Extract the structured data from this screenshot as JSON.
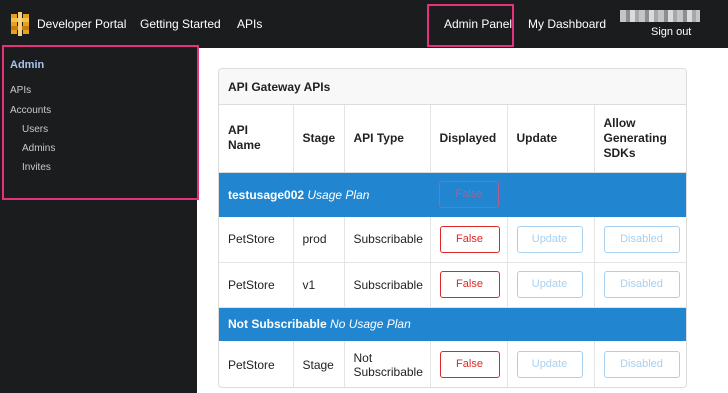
{
  "nav": {
    "brand": "Developer Portal",
    "getting_started": "Getting Started",
    "apis": "APIs",
    "admin_panel": "Admin Panel",
    "my_dashboard": "My Dashboard",
    "sign_out": "Sign out",
    "logo_icon": "developer-portal-logo-icon"
  },
  "sidebar": {
    "heading": "Admin",
    "items": [
      {
        "label": "APIs"
      },
      {
        "label": "Accounts"
      },
      {
        "label": "Users"
      },
      {
        "label": "Admins"
      },
      {
        "label": "Invites"
      }
    ]
  },
  "panel": {
    "title": "API Gateway APIs",
    "columns": [
      "API Name",
      "Stage",
      "API Type",
      "Displayed",
      "Update",
      "Allow Generating SDKs"
    ],
    "groups": [
      {
        "name": "testusage002",
        "plan": "Usage Plan",
        "displayed": "False",
        "rows": [
          {
            "api_name": "PetStore",
            "stage": "prod",
            "api_type": "Subscribable",
            "displayed": "False",
            "update": "Update",
            "sdk": "Disabled"
          },
          {
            "api_name": "PetStore",
            "stage": "v1",
            "api_type": "Subscribable",
            "displayed": "False",
            "update": "Update",
            "sdk": "Disabled"
          }
        ]
      },
      {
        "name": "Not Subscribable",
        "plan": "No Usage Plan",
        "rows": [
          {
            "api_name": "PetStore",
            "stage": "Stage",
            "api_type": "Not Subscribable",
            "displayed": "False",
            "update": "Update",
            "sdk": "Disabled"
          }
        ]
      }
    ]
  },
  "colors": {
    "highlight": "#e6317b",
    "group_row": "#2185d0",
    "danger": "#db2828",
    "nav_bg": "#1b1c1d"
  }
}
